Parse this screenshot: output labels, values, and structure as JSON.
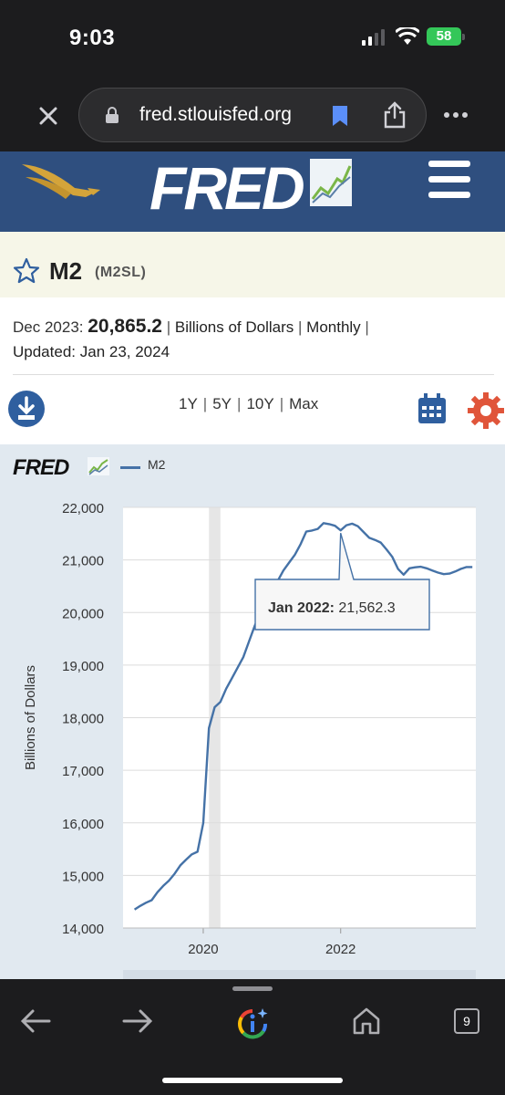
{
  "status": {
    "time": "9:03",
    "battery": "58"
  },
  "browser": {
    "url": "fred.stlouisfed.org"
  },
  "header": {
    "logo_text": "FRED"
  },
  "series": {
    "title": "M2",
    "id": "(M2SL)",
    "date_label": "Dec 2023:",
    "value": "20,865.2",
    "units": "Billions of Dollars",
    "frequency": "Monthly",
    "updated_label": "Updated:",
    "updated_date": "Jan 23, 2024"
  },
  "ranges": [
    "1Y",
    "5Y",
    "10Y",
    "Max"
  ],
  "chart_legend": {
    "logo_text": "FRED",
    "series_name": "M2"
  },
  "tooltip": {
    "date": "Jan 2022:",
    "value": "21,562.3"
  },
  "chart_data": {
    "type": "line",
    "title": "",
    "ylabel": "Billions of Dollars",
    "xlabel": "",
    "ylim": [
      14000,
      22000
    ],
    "yticks": [
      "22,000",
      "21,000",
      "20,000",
      "19,000",
      "18,000",
      "17,000",
      "16,000",
      "15,000",
      "14,000"
    ],
    "xticks": [
      "2020",
      "2022"
    ],
    "recession_shading": {
      "start": "2020-02",
      "end": "2020-04"
    },
    "series": [
      {
        "name": "M2",
        "color": "#4572a7",
        "x": [
          "2019-01",
          "2019-02",
          "2019-03",
          "2019-04",
          "2019-05",
          "2019-06",
          "2019-07",
          "2019-08",
          "2019-09",
          "2019-10",
          "2019-11",
          "2019-12",
          "2020-01",
          "2020-02",
          "2020-03",
          "2020-04",
          "2020-05",
          "2020-06",
          "2020-07",
          "2020-08",
          "2020-09",
          "2020-10",
          "2020-11",
          "2020-12",
          "2021-01",
          "2021-02",
          "2021-03",
          "2021-04",
          "2021-05",
          "2021-06",
          "2021-07",
          "2021-08",
          "2021-09",
          "2021-10",
          "2021-11",
          "2021-12",
          "2022-01",
          "2022-02",
          "2022-03",
          "2022-04",
          "2022-05",
          "2022-06",
          "2022-07",
          "2022-08",
          "2022-09",
          "2022-10",
          "2022-11",
          "2022-12",
          "2023-01",
          "2023-02",
          "2023-03",
          "2023-04",
          "2023-05",
          "2023-06",
          "2023-07",
          "2023-08",
          "2023-09",
          "2023-10",
          "2023-11",
          "2023-12"
        ],
        "values": [
          14350,
          14420,
          14480,
          14530,
          14680,
          14800,
          14900,
          15030,
          15190,
          15300,
          15400,
          15450,
          16000,
          17800,
          18200,
          18300,
          18550,
          18750,
          18950,
          19150,
          19450,
          19750,
          20000,
          20250,
          20450,
          20600,
          20800,
          20950,
          21100,
          21300,
          21540,
          21560,
          21590,
          21700,
          21680,
          21650,
          21562.3,
          21660,
          21690,
          21640,
          21530,
          21420,
          21380,
          21330,
          21200,
          21060,
          20830,
          20720,
          20840,
          20860,
          20870,
          20840,
          20800,
          20760,
          20730,
          20740,
          20780,
          20830,
          20865.2,
          20865.2
        ]
      }
    ]
  }
}
